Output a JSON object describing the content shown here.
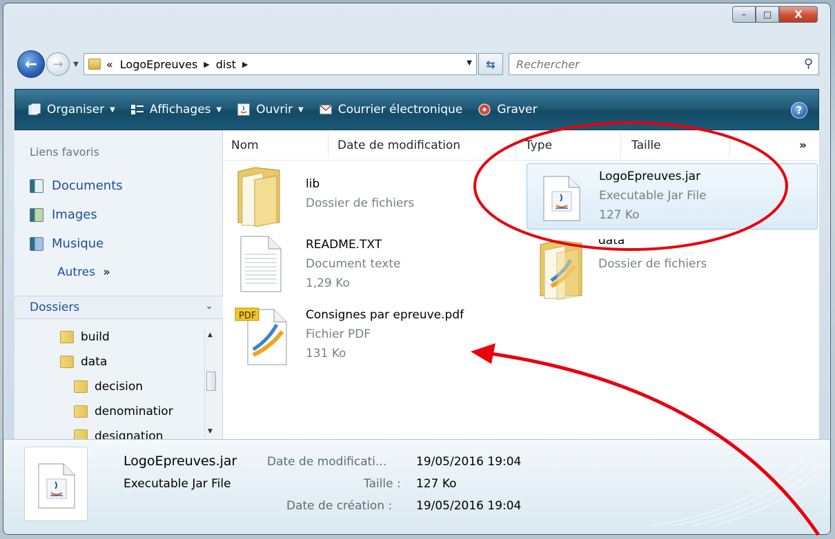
{
  "window": {
    "caption": {
      "minimize": "–",
      "maximize": "□",
      "close": "X"
    }
  },
  "address": {
    "overflow_glyph": "«",
    "crumbs": [
      "LogoEpreuves",
      "dist"
    ],
    "separator": "▶",
    "search_placeholder": "Rechercher"
  },
  "toolbar": {
    "organise": "Organiser",
    "views": "Affichages",
    "open": "Ouvrir",
    "email": "Courrier électronique",
    "burn": "Graver",
    "help": "?"
  },
  "nav": {
    "favorites_heading": "Liens favoris",
    "favorites": [
      "Documents",
      "Images",
      "Musique"
    ],
    "more": "Autres",
    "more_glyph": "»",
    "folders_heading": "Dossiers",
    "tree": [
      "build",
      "data",
      "decision",
      "denominatior",
      "designation"
    ]
  },
  "columns": {
    "name": "Nom",
    "date": "Date de modification",
    "type": "Type",
    "size": "Taille",
    "more": "»"
  },
  "files": [
    {
      "name": "lib",
      "type": "Dossier de fichiers",
      "size": ""
    },
    {
      "name": "README.TXT",
      "type": "Document texte",
      "size": "1,29 Ko"
    },
    {
      "name": "Consignes par epreuve.pdf",
      "type": "Fichier PDF",
      "size": "131 Ko",
      "badge": "PDF"
    },
    {
      "name": "LogoEpreuves.jar",
      "type": "Executable Jar File",
      "size": "127 Ko"
    },
    {
      "name": "data",
      "type": "Dossier de fichiers",
      "size": ""
    }
  ],
  "details": {
    "name": "LogoEpreuves.jar",
    "type": "Executable Jar File",
    "modified_label": "Date de modificati...",
    "modified_value": "19/05/2016 19:04",
    "size_label": "Taille :",
    "size_value": "127 Ko",
    "created_label": "Date de création :",
    "created_value": "19/05/2016 19:04"
  },
  "colors": {
    "annotation": "#e8000d",
    "toolbar": "#1f5a78",
    "link": "#1a4f9c",
    "selection": "#dcecf8"
  }
}
